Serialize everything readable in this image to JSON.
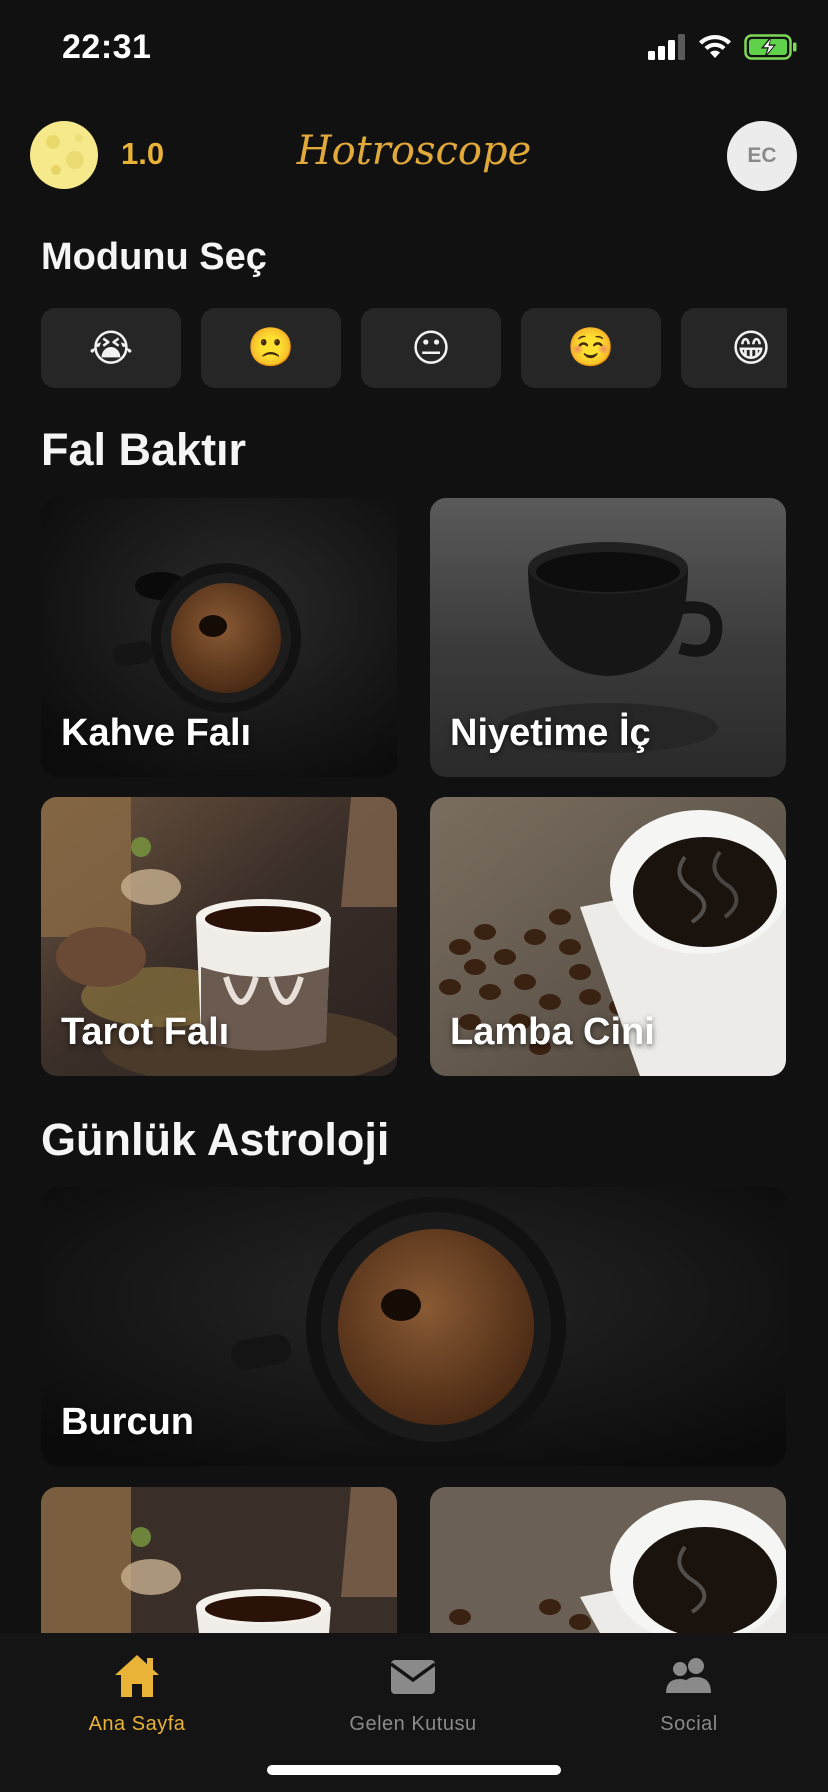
{
  "status_bar": {
    "time": "22:31",
    "icons": [
      "cellular-signal-icon",
      "wifi-icon",
      "battery-charging-icon"
    ]
  },
  "header": {
    "moon_icon": "moon-icon",
    "credits": "1.0",
    "logo": "Hotroscope",
    "avatar_initials": "EC"
  },
  "mood": {
    "title": "Modunu Seç",
    "options": [
      "😭",
      "🙁",
      "😐",
      "☺️",
      "😁"
    ]
  },
  "fal": {
    "title": "Fal Baktır",
    "cards": [
      {
        "label": "Kahve Falı"
      },
      {
        "label": "Niyetime İç"
      },
      {
        "label": "Tarot Falı"
      },
      {
        "label": "Lamba Cini"
      }
    ]
  },
  "astrology": {
    "title": "Günlük Astroloji",
    "cards": [
      {
        "label": "Burcun"
      }
    ]
  },
  "tab_bar": {
    "tabs": [
      {
        "label": "Ana Sayfa",
        "icon": "home-icon",
        "active": true
      },
      {
        "label": "Gelen Kutusu",
        "icon": "mail-icon",
        "active": false
      },
      {
        "label": "Social",
        "icon": "people-icon",
        "active": false
      }
    ]
  },
  "colors": {
    "background": "#111111",
    "accent": "#e9b338",
    "card": "#262626",
    "inactive": "#8a8a8a"
  }
}
